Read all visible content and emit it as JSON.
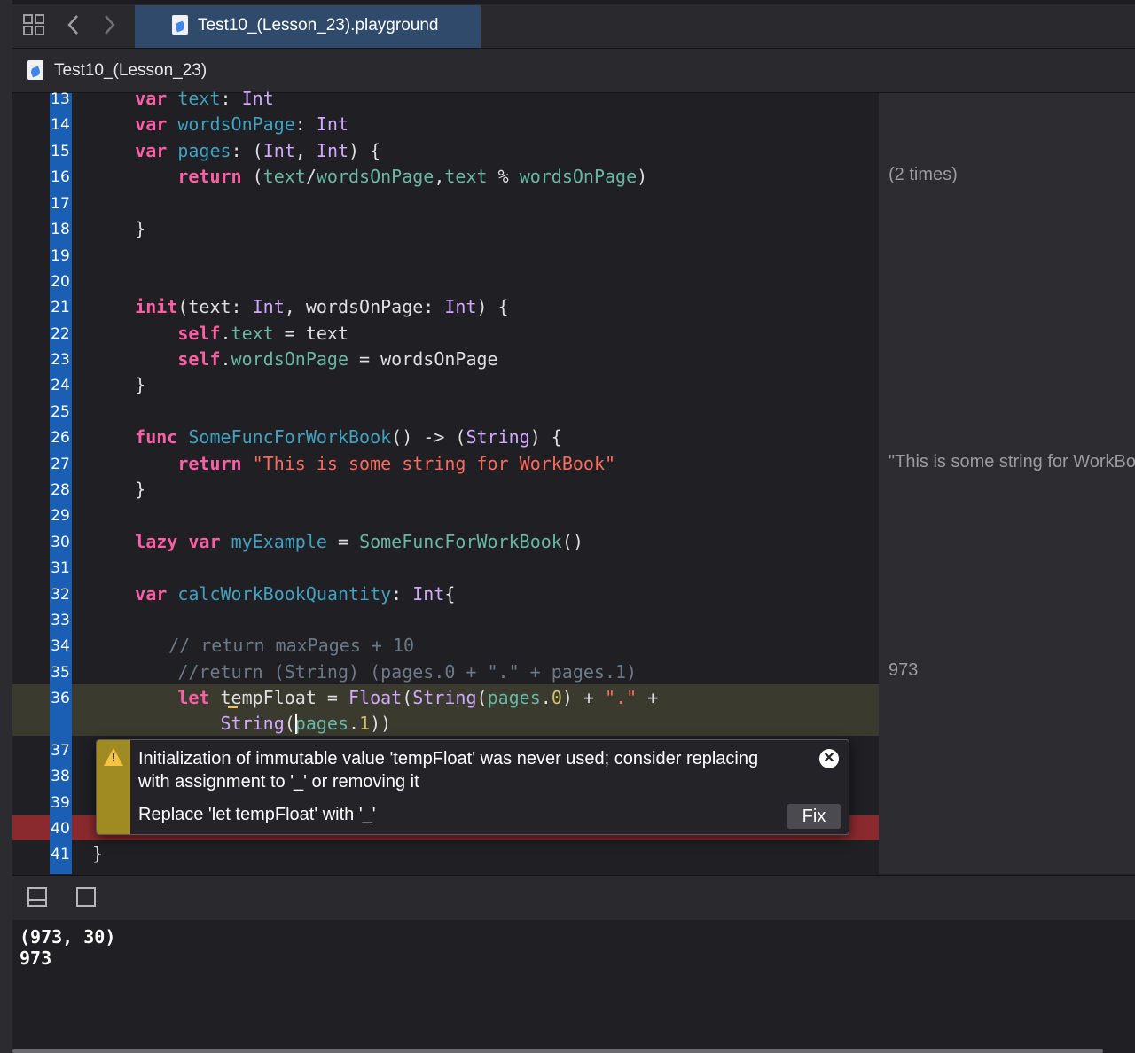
{
  "tabbar": {
    "active_tab": "Test10_(Lesson_23).playground"
  },
  "jumpbar": {
    "file": "Test10_(Lesson_23)"
  },
  "editor": {
    "line_numbers": [
      "13",
      "14",
      "15",
      "16",
      "17",
      "18",
      "19",
      "20",
      "21",
      "22",
      "23",
      "24",
      "25",
      "26",
      "27",
      "28",
      "29",
      "30",
      "31",
      "32",
      "33",
      "34",
      "35",
      "36",
      "37",
      "38",
      "39",
      "40",
      "41"
    ],
    "lines": {
      "l13": [
        [
          "    ",
          "p"
        ],
        [
          "var",
          "kw"
        ],
        [
          " ",
          "p"
        ],
        [
          "text",
          "decl"
        ],
        [
          ": ",
          "p"
        ],
        [
          "Int",
          "typ"
        ]
      ],
      "l14": [
        [
          "    ",
          "p"
        ],
        [
          "var",
          "kw"
        ],
        [
          " ",
          "p"
        ],
        [
          "wordsOnPage",
          "decl"
        ],
        [
          ": ",
          "p"
        ],
        [
          "Int",
          "typ"
        ]
      ],
      "l15": [
        [
          "    ",
          "p"
        ],
        [
          "var",
          "kw"
        ],
        [
          " ",
          "p"
        ],
        [
          "pages",
          "decl"
        ],
        [
          ": (",
          "p"
        ],
        [
          "Int",
          "typ"
        ],
        [
          ", ",
          "p"
        ],
        [
          "Int",
          "typ"
        ],
        [
          ") {",
          "p"
        ]
      ],
      "l16": [
        [
          "        ",
          "p"
        ],
        [
          "return",
          "kw"
        ],
        [
          " (",
          "p"
        ],
        [
          "text",
          "prop"
        ],
        [
          "/",
          "p"
        ],
        [
          "wordsOnPage",
          "prop"
        ],
        [
          ",",
          "p"
        ],
        [
          "text",
          "prop"
        ],
        [
          " % ",
          "p"
        ],
        [
          "wordsOnPage",
          "prop"
        ],
        [
          ")",
          "p"
        ]
      ],
      "l18": [
        [
          "    }",
          "p"
        ]
      ],
      "l21": [
        [
          "    ",
          "p"
        ],
        [
          "init",
          "kw"
        ],
        [
          "(text: ",
          "p"
        ],
        [
          "Int",
          "typ"
        ],
        [
          ", wordsOnPage: ",
          "p"
        ],
        [
          "Int",
          "typ"
        ],
        [
          ") {",
          "p"
        ]
      ],
      "l22": [
        [
          "        ",
          "p"
        ],
        [
          "self",
          "kw"
        ],
        [
          ".",
          "p"
        ],
        [
          "text",
          "prop"
        ],
        [
          " = text",
          "p"
        ]
      ],
      "l23": [
        [
          "        ",
          "p"
        ],
        [
          "self",
          "kw"
        ],
        [
          ".",
          "p"
        ],
        [
          "wordsOnPage",
          "prop"
        ],
        [
          " = wordsOnPage",
          "p"
        ]
      ],
      "l24": [
        [
          "    }",
          "p"
        ]
      ],
      "l26": [
        [
          "    ",
          "p"
        ],
        [
          "func",
          "kw"
        ],
        [
          " ",
          "p"
        ],
        [
          "SomeFuncForWorkBook",
          "decl"
        ],
        [
          "() -> (",
          "p"
        ],
        [
          "String",
          "typ"
        ],
        [
          ") {",
          "p"
        ]
      ],
      "l27": [
        [
          "        ",
          "p"
        ],
        [
          "return",
          "kw"
        ],
        [
          " ",
          "p"
        ],
        [
          "\"This is some string for WorkBook\"",
          "str"
        ]
      ],
      "l28": [
        [
          "    }",
          "p"
        ]
      ],
      "l30": [
        [
          "    ",
          "p"
        ],
        [
          "lazy",
          "kw"
        ],
        [
          " ",
          "p"
        ],
        [
          "var",
          "kw"
        ],
        [
          " ",
          "p"
        ],
        [
          "myExample",
          "decl"
        ],
        [
          " = ",
          "p"
        ],
        [
          "SomeFuncForWorkBook",
          "prop"
        ],
        [
          "()",
          "p"
        ]
      ],
      "l32": [
        [
          "    ",
          "p"
        ],
        [
          "var",
          "kw"
        ],
        [
          " ",
          "p"
        ],
        [
          "calcWorkBookQuantity",
          "decl"
        ],
        [
          ": ",
          "p"
        ],
        [
          "Int",
          "typ"
        ],
        [
          "{",
          "p"
        ]
      ],
      "l34": [
        [
          "   // return maxPages + 10",
          "cmt"
        ]
      ],
      "l35": [
        [
          "        //return (String) (pages.0 + \".\" + pages.1)",
          "cmt"
        ]
      ],
      "l36a": [
        [
          "        ",
          "p"
        ],
        [
          "let",
          "kw"
        ],
        [
          " tempFloat = ",
          "p"
        ],
        [
          "Float",
          "typ"
        ],
        [
          "(",
          "p"
        ],
        [
          "String",
          "typ"
        ],
        [
          "(",
          "p"
        ],
        [
          "pages",
          "prop"
        ],
        [
          ".",
          "p"
        ],
        [
          "0",
          "num"
        ],
        [
          ") + ",
          "p"
        ],
        [
          "\".\"",
          "str"
        ],
        [
          " +",
          "p"
        ]
      ],
      "l36b": [
        [
          "            ",
          "p"
        ],
        [
          "String",
          "typ"
        ],
        [
          "(",
          "p"
        ],
        [
          "pages",
          "prop"
        ],
        [
          ".",
          "p"
        ],
        [
          "1",
          "num"
        ],
        [
          "))",
          "p"
        ]
      ],
      "l41": [
        [
          "}",
          "p"
        ]
      ]
    }
  },
  "results": {
    "r16": "(2 times)",
    "r27": "\"This is some string for WorkBook\"",
    "r35": "973"
  },
  "popup": {
    "message": "Initialization of immutable value 'tempFloat' was never used; consider replacing with assignment to '_' or removing it",
    "fix_description": "Replace 'let tempFloat' with '_'",
    "fix_button": "Fix",
    "close_glyph": "✕",
    "warning_glyph": "!"
  },
  "console": {
    "output": "(973, 30)\n973"
  },
  "colors": {
    "keyword": "#fc5fa3",
    "type": "#d0a8ff",
    "property": "#67b7a4",
    "string": "#fc6a5d",
    "comment": "#6c7986",
    "number": "#d0bf69",
    "declaration": "#41a1c0",
    "line_number_gutter": "#1a5fb4",
    "warning": "#f5c542",
    "error_line": "#8b2a2e"
  }
}
